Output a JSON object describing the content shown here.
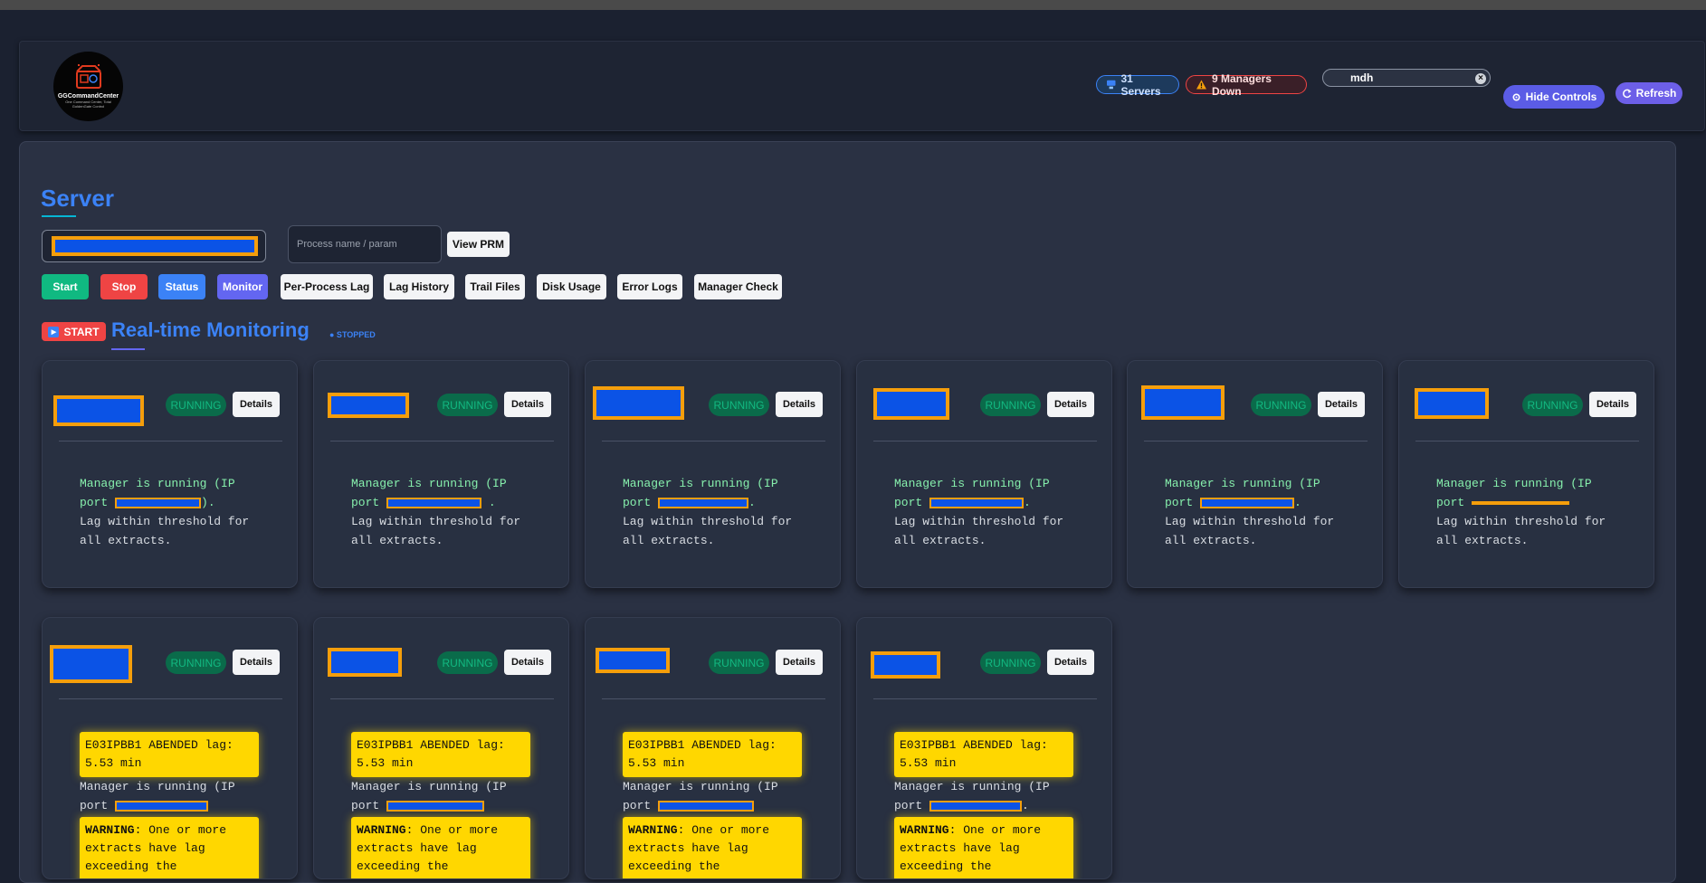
{
  "header": {
    "logo_title": "GGCommandCenter",
    "logo_subtitle": "One Command Center, Total GoldenGate Control",
    "servers_label": "31 Servers",
    "managers_down_label": "9 Managers Down",
    "search_value": "mdh",
    "search_clear": "×",
    "hide_controls_label": "Hide Controls",
    "refresh_label": "Refresh"
  },
  "server_section": {
    "title": "Server",
    "process_placeholder": "Process name / param",
    "view_prm_label": "View PRM",
    "actions": {
      "start": "Start",
      "stop": "Stop",
      "status": "Status",
      "monitor": "Monitor",
      "per_process_lag": "Per-Process Lag",
      "lag_history": "Lag History",
      "trail_files": "Trail Files",
      "disk_usage": "Disk Usage",
      "error_logs": "Error Logs",
      "manager_check": "Manager Check"
    }
  },
  "monitoring": {
    "start_label": "START",
    "title": "Real-time Monitoring",
    "state": "● STOPPED"
  },
  "card_common": {
    "status": "RUNNING",
    "details_label": "Details",
    "manager_line1": "Manager is running (IP",
    "port_prefix": "port",
    "lag_ok": "Lag within threshold for all extracts.",
    "abend": "E03IPBB1 ABENDED lag: 5.53 min",
    "warning_label": "WARNING",
    "warning_text": ": One or more extracts have lag exceeding the threshold!"
  },
  "colors": {
    "accent": "#3b82f6",
    "running": "#10b981",
    "danger": "#ef4444",
    "warning": "#ffd700",
    "monitor": "#6366f1"
  }
}
